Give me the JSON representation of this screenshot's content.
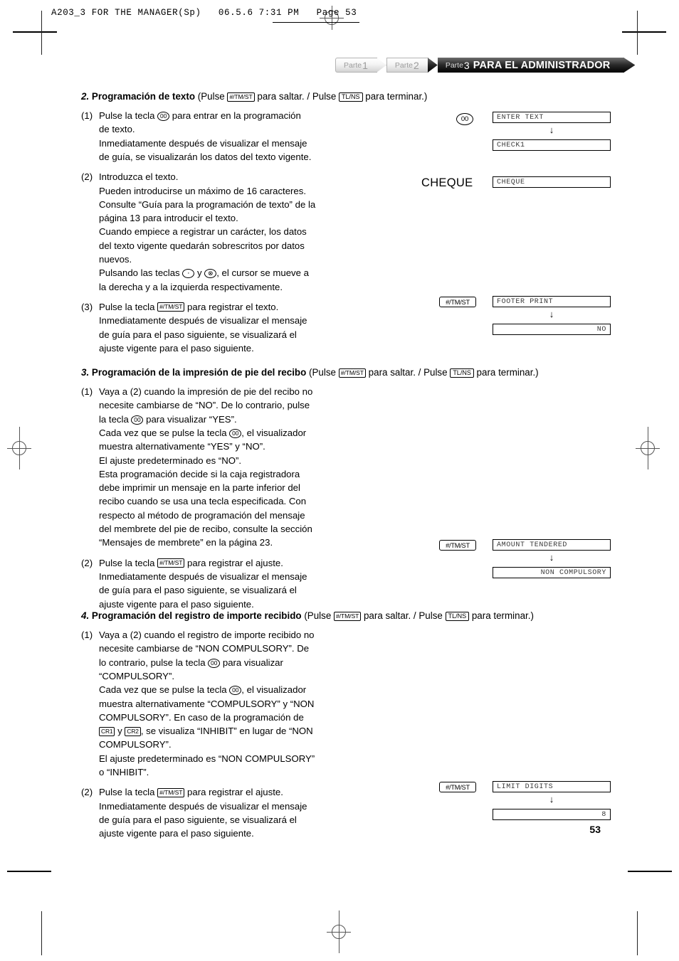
{
  "file_header": {
    "text": "A203_3 FOR THE MANAGER(Sp)   06.5.6 7:31 PM   Page 53"
  },
  "breadcrumb": {
    "items": [
      {
        "label": "Parte",
        "number": "1",
        "title": ""
      },
      {
        "label": "Parte",
        "number": "2",
        "title": ""
      },
      {
        "label": "Parte",
        "number": "3",
        "title": "PARA EL ADMINISTRADOR"
      }
    ]
  },
  "keys": {
    "tmst": "#/TM/ST",
    "tlns": "TL/NS",
    "zerozero": "00",
    "dot": "·",
    "multiply": "⊗",
    "cr1": "CR1",
    "cr2": "CR2"
  },
  "sections": [
    {
      "number": "2.",
      "title": "Programación de texto",
      "paren_pre": "(Pulse",
      "paren_mid": "para saltar. / Pulse",
      "paren_post": "para terminar.)",
      "steps": [
        {
          "marker": "(1)",
          "lines": [
            "Pulse la tecla ⟦00⟧ para entrar en la programación",
            "de texto.",
            "Inmediatamente después de visualizar el mensaje",
            "de guía, se visualizarán los datos del texto vigente."
          ]
        },
        {
          "marker": "(2)",
          "lines": [
            "Introduzca el texto.",
            "Pueden introducirse un máximo de 16 caracteres.",
            "Consulte “Guía para la programación de texto” de la",
            "página 13 para introducir el texto.",
            "Cuando empiece a registrar un carácter, los datos",
            "del texto vigente quedarán sobrescritos por datos",
            "nuevos.",
            "Pulsando las teclas ⟦·⟧ y ⟦⊗⟧, el cursor se mueve a",
            "la derecha y a la izquierda respectivamente."
          ]
        },
        {
          "marker": "(3)",
          "lines": [
            "Pulse la tecla ⟦#/TM/ST⟧ para registrar el texto.",
            "Inmediatamente después de visualizar el mensaje",
            "de guía para el paso siguiente, se visualizará el",
            "ajuste vigente para el paso siguiente."
          ]
        }
      ]
    },
    {
      "number": "3.",
      "title": "Programación de la impresión de pie del recibo",
      "paren_pre": "(Pulse",
      "paren_mid": "para saltar. / Pulse",
      "paren_post": "para terminar.)",
      "steps": [
        {
          "marker": "(1)",
          "lines": [
            "Vaya a (2) cuando la impresión de pie del recibo no",
            "necesite cambiarse de “NO”. De lo contrario, pulse",
            "la tecla ⟦00⟧ para visualizar “YES”.",
            "Cada vez que se pulse la tecla ⟦00⟧, el visualizador",
            "muestra alternativamente “YES” y “NO”.",
            "El ajuste predeterminado es “NO”.",
            "Esta programación decide si la caja registradora",
            "debe imprimir un mensaje en la parte inferior del",
            "recibo cuando se usa una tecla especificada. Con",
            "respecto al método de programación del mensaje",
            "del membrete del pie de recibo, consulte la sección",
            "“Mensajes de membrete” en la página 23."
          ]
        },
        {
          "marker": "(2)",
          "lines": [
            "Pulse la tecla ⟦#/TM/ST⟧ para registrar el ajuste.",
            "Inmediatamente después de visualizar el mensaje",
            "de guía para el paso siguiente, se visualizará el",
            "ajuste vigente para el paso siguiente."
          ]
        }
      ]
    },
    {
      "number": "4.",
      "title": "Programación del registro de importe recibido",
      "paren_pre": "(Pulse",
      "paren_mid": "para saltar. / Pulse",
      "paren_post": "para terminar.)",
      "steps": [
        {
          "marker": "(1)",
          "lines": [
            "Vaya a (2) cuando el registro de importe recibido no",
            "necesite cambiarse de “NON COMPULSORY”. De",
            "lo contrario, pulse la tecla ⟦00⟧ para visualizar",
            "“COMPULSORY”.",
            "Cada vez que se pulse la tecla ⟦00⟧, el visualizador",
            "muestra alternativamente “COMPULSORY” y “NON",
            "COMPULSORY”. En caso de la programación de",
            "⟦CR1⟧ y ⟦CR2⟧, se visualiza “INHIBIT” en lugar de “NON",
            "COMPULSORY”.",
            "El ajuste predeterminado es “NON COMPULSORY”",
            "o “INHIBIT”."
          ]
        },
        {
          "marker": "(2)",
          "lines": [
            "Pulse la tecla ⟦#/TM/ST⟧ para registrar el ajuste.",
            "Inmediatamente después de visualizar el mensaje",
            "de guía para el paso siguiente, se visualizará el",
            "ajuste vigente para el paso siguiente."
          ]
        }
      ]
    }
  ],
  "display_groups": [
    {
      "key": "00",
      "key_shape": "round",
      "top": "ENTER TEXT",
      "bottom": "CHECK1",
      "bottom_align": "left"
    },
    {
      "key": "",
      "key_shape": "none",
      "top": "CHEQUE",
      "bottom": "",
      "bottom_align": "left",
      "big_label": "CHEQUE"
    },
    {
      "key": "#/TM/ST",
      "key_shape": "box",
      "top": "FOOTER PRINT",
      "bottom": "NO",
      "bottom_align": "right"
    },
    {
      "key": "#/TM/ST",
      "key_shape": "box",
      "top": "AMOUNT TENDERED",
      "bottom": "NON COMPULSORY",
      "bottom_align": "right"
    },
    {
      "key": "#/TM/ST",
      "key_shape": "box",
      "top": "LIMIT DIGITS",
      "bottom": "8",
      "bottom_align": "right"
    }
  ],
  "arrow_glyph": "↓",
  "page_number": "53"
}
